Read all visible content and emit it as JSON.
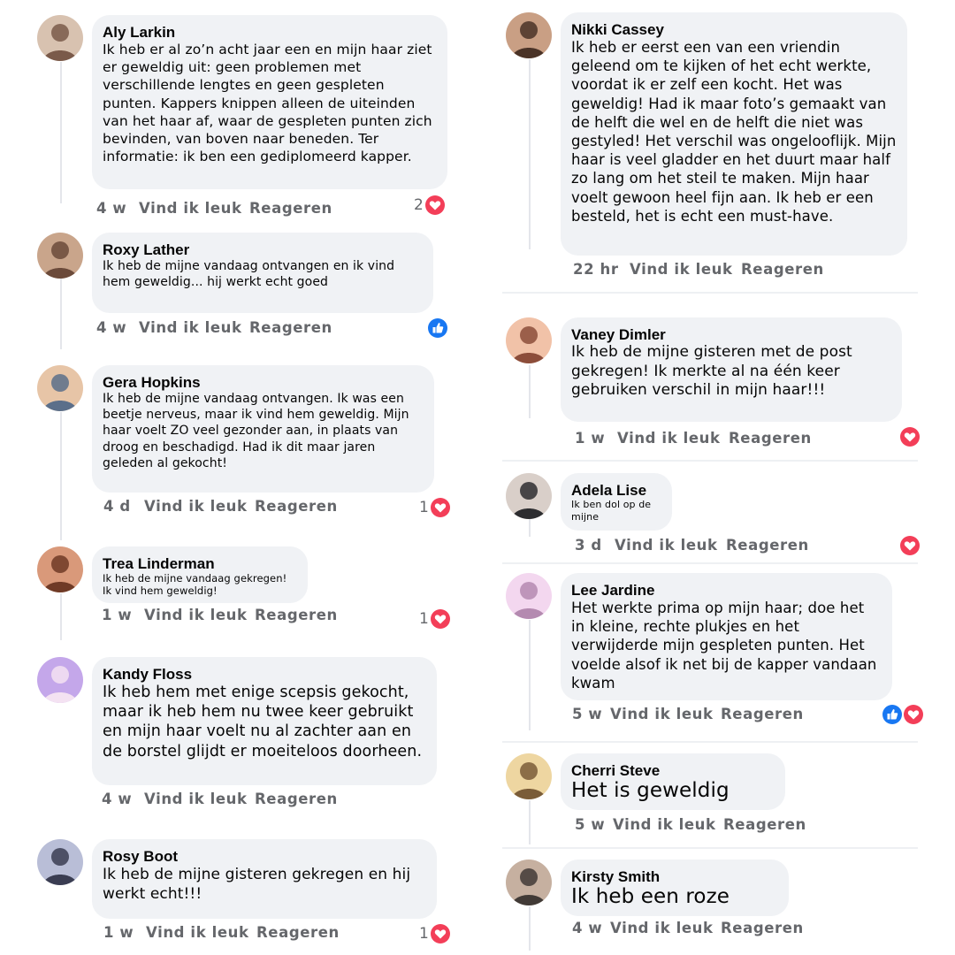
{
  "actions": {
    "like": "Vind ik leuk",
    "reply": "Reageren"
  },
  "comments": [
    {
      "author": "Aly Larkin",
      "text": "Ik heb er al zo’n acht jaar een en mijn haar ziet er geweldig uit: geen problemen met verschillende lengtes en geen gespleten punten. Kappers knippen alleen de uiteinden van het haar af, waar de gespleten punten zich bevinden, van boven naar beneden. Ter informatie: ik ben een gediplomeerd kapper.",
      "time": "4 w",
      "reaction_count": "2",
      "reactions": [
        "love-icon"
      ]
    },
    {
      "author": "Roxy Lather",
      "text": "Ik heb de mijne vandaag ontvangen en ik vind hem geweldig... hij werkt echt goed",
      "time": "4 w",
      "reaction_count": "",
      "reactions": [
        "like-icon"
      ]
    },
    {
      "author": "Gera Hopkins",
      "text": "Ik heb de mijne vandaag ontvangen. Ik was een beetje nerveus, maar ik vind hem geweldig. Mijn haar voelt ZO veel gezonder aan, in plaats van droog en beschadigd. Had ik dit maar jaren geleden al gekocht!",
      "time": "4 d",
      "reaction_count": "1",
      "reactions": [
        "love-icon"
      ]
    },
    {
      "author": "Trea Linderman",
      "text": "Ik heb de mijne vandaag gekregen! Ik vind hem geweldig!",
      "time": "1 w",
      "reaction_count": "1",
      "reactions": [
        "love-icon"
      ]
    },
    {
      "author": "Kandy Floss",
      "text": "Ik heb hem met enige scepsis gekocht, maar ik heb hem nu twee keer gebruikt en mijn haar voelt nu al zachter aan en de borstel glijdt er moeiteloos doorheen.",
      "time": "4 w",
      "reaction_count": "",
      "reactions": []
    },
    {
      "author": "Rosy Boot",
      "text": "Ik heb de mijne gisteren gekregen en hij werkt echt!!!",
      "time": "1 w",
      "reaction_count": "1",
      "reactions": [
        "love-icon"
      ]
    },
    {
      "author": "Nikki Cassey",
      "text": "Ik heb er eerst een van een vriendin geleend om te kijken of het echt werkte, voordat ik er zelf een kocht. Het was geweldig! Had ik maar foto’s gemaakt van de helft die wel en de helft die niet was gestyled! Het verschil was ongelooflijk. Mijn haar is veel gladder en het duurt maar half zo lang om het steil te maken. Mijn haar voelt gewoon heel fijn aan. Ik heb er een besteld, het is echt een must-have.",
      "time": "22 hr",
      "reaction_count": "",
      "reactions": []
    },
    {
      "author": "Vaney Dimler",
      "text": "Ik heb de mijne gisteren met de post gekregen! Ik merkte al na één keer gebruiken verschil in mijn haar!!!",
      "time": "1 w",
      "reaction_count": "",
      "reactions": [
        "love-icon"
      ]
    },
    {
      "author": "Adela Lise",
      "text": "Ik ben dol op de mijne",
      "time": "3 d",
      "reaction_count": "",
      "reactions": [
        "love-icon"
      ]
    },
    {
      "author": "Lee Jardine",
      "text": "Het werkte prima op mijn haar; doe het in kleine, rechte plukjes en het verwijderde mijn gespleten punten. Het voelde alsof ik net bij de kapper vandaan kwam",
      "time": "5 w",
      "reaction_count": "",
      "reactions": [
        "like-icon",
        "love-icon"
      ]
    },
    {
      "author": "Cherri Steve",
      "text": "Het is geweldig",
      "time": "5 w",
      "reaction_count": "",
      "reactions": []
    },
    {
      "author": "Kirsty Smith",
      "text": "Ik heb een roze",
      "time": "4 w",
      "reaction_count": "",
      "reactions": []
    }
  ],
  "colors": {
    "bubble": "#f0f2f5",
    "meta": "#65676b",
    "love": "#f33e58",
    "like": "#1877f2"
  }
}
